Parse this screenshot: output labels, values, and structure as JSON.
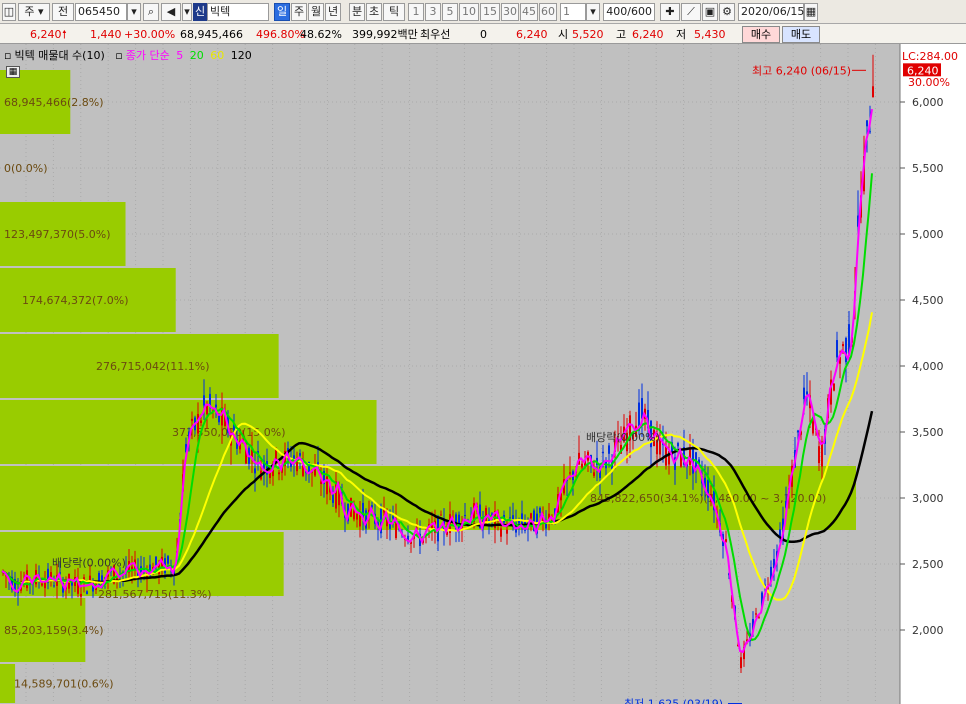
{
  "toolbar": {
    "market_type": "주",
    "prev": "전",
    "stock_code": "065450",
    "sin_label": "신",
    "stock_name": "빅텍",
    "periods": [
      "일",
      "주",
      "월",
      "년",
      "분",
      "초",
      "틱"
    ],
    "selected_period": "일",
    "intervals": [
      "1",
      "3",
      "5",
      "10",
      "15",
      "30",
      "45",
      "60"
    ],
    "interval_value": "1",
    "count": "400",
    "count_max": "/600",
    "date": "2020/06/15"
  },
  "quote": {
    "price": "6,240",
    "change": "1,440",
    "change_pct": "+30.00%",
    "volume": "68,945,466",
    "volume_ratio": "496.80%",
    "turnover": "48.62%",
    "trade_value": "399,992백만",
    "best_bid_label": "최우선",
    "best_bid": "0",
    "price2": "6,240",
    "open_label": "시",
    "open": "5,520",
    "high_label": "고",
    "high": "6,240",
    "low_label": "저",
    "low": "5,430",
    "buy_label": "매수",
    "sell_label": "매도"
  },
  "legend": {
    "volume_profile": "빅텍 매물대 수(10)",
    "ma_label": "종가 단순",
    "ma5": "5",
    "ma20": "20",
    "ma60": "60",
    "ma120": "120"
  },
  "colors": {
    "ma5": "#ff00ff",
    "ma20": "#00dd00",
    "ma60": "#ffff00",
    "ma120": "#000000",
    "up": "#e00000",
    "down": "#0030e0",
    "profile": "#99cc00"
  },
  "chart_data": {
    "type": "candlestick",
    "y_axis_ticks": [
      "6,000",
      "5,500",
      "5,000",
      "4,500",
      "4,000",
      "3,500",
      "3,000",
      "2,500",
      "2,000"
    ],
    "ylim": [
      1600,
      6400
    ],
    "current_price_tag": "6,240",
    "upper_limit_tag": "LC:284.00",
    "upper_limit_pct": "30.00%",
    "high_annotation": "최고 6,240 (06/15)",
    "low_annotation": "최저 1,625 (03/19)",
    "dividend_labels": [
      "배당락(0.00%)",
      "배당락(0.00%)"
    ],
    "volume_profile": [
      {
        "range": [
          5750,
          6250
        ],
        "label": "68,945,466(2.8%)",
        "share": 2.8
      },
      {
        "range": [
          5250,
          5750
        ],
        "label": "0(0.0%)",
        "share": 0.0
      },
      {
        "range": [
          4750,
          5250
        ],
        "label": "123,497,370(5.0%)",
        "share": 5.0
      },
      {
        "range": [
          4250,
          4750
        ],
        "label": "174,674,372(7.0%)",
        "share": 7.0
      },
      {
        "range": [
          3750,
          4250
        ],
        "label": "276,715,042(11.1%)",
        "share": 11.1
      },
      {
        "range": [
          3250,
          3750
        ],
        "label": "373,350,090(15.0%)",
        "share": 15.0
      },
      {
        "range": [
          2750,
          3250
        ],
        "label": "845,822,650(34.1%)(3,480.00 ~ 3,120.00)",
        "share": 34.1
      },
      {
        "range": [
          2250,
          2750
        ],
        "label": "281,567,715(11.3%)",
        "share": 11.3
      },
      {
        "range": [
          1750,
          2250
        ],
        "label": "85,203,159(3.4%)",
        "share": 3.4
      },
      {
        "range": [
          1250,
          1750
        ],
        "label": "14,589,701(0.6%)",
        "share": 0.6
      }
    ],
    "moving_average_periods": [
      5,
      20,
      60,
      120
    ]
  }
}
